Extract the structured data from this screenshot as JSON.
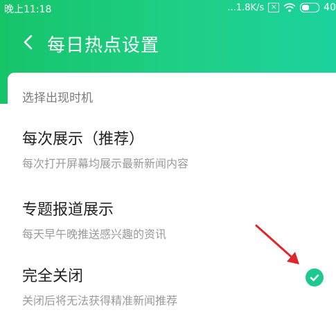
{
  "status_bar": {
    "time": "晚上11:18",
    "speed": "...1.8K/s",
    "battery": "40"
  },
  "header": {
    "title": "每日热点设置",
    "accent_color": "#1ccf88"
  },
  "section": {
    "label": "选择出现时机"
  },
  "options": [
    {
      "title": "每次展示（推荐）",
      "desc": "每次打开屏幕均展示最新新闻内容",
      "selected": false
    },
    {
      "title": "专题报道展示",
      "desc": "每天早午晚推送感兴趣的资讯",
      "selected": false
    },
    {
      "title": "完全关闭",
      "desc": "关闭后将无法获得精准新闻推荐",
      "selected": true
    }
  ],
  "icons": {
    "back": "chevron-left-icon",
    "check": "check-circle-icon",
    "arrow": "red-arrow-annotation"
  }
}
